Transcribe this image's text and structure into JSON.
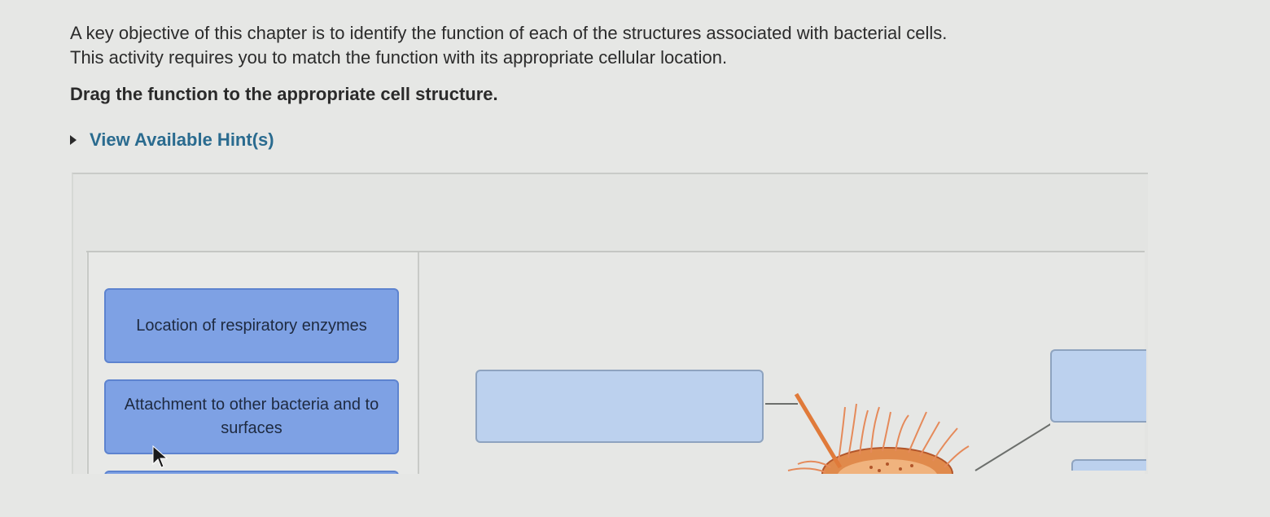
{
  "intro_text": "A key objective of this chapter is to identify the function of each of the structures associated with bacterial cells. This activity requires you to match the function with its appropriate cellular location.",
  "instruction_text": "Drag the function to the appropriate cell structure.",
  "hint_link": "View Available Hint(s)",
  "functions": [
    {
      "label": "Location of respiratory enzymes"
    },
    {
      "label": "Attachment to other bacteria and to surfaces"
    },
    {
      "label": ""
    }
  ],
  "colors": {
    "label_fill": "#7ea1e4",
    "target_fill": "#bcd1ee",
    "hint_link": "#2a6b8f",
    "cell_fill": "#e08a4c"
  }
}
